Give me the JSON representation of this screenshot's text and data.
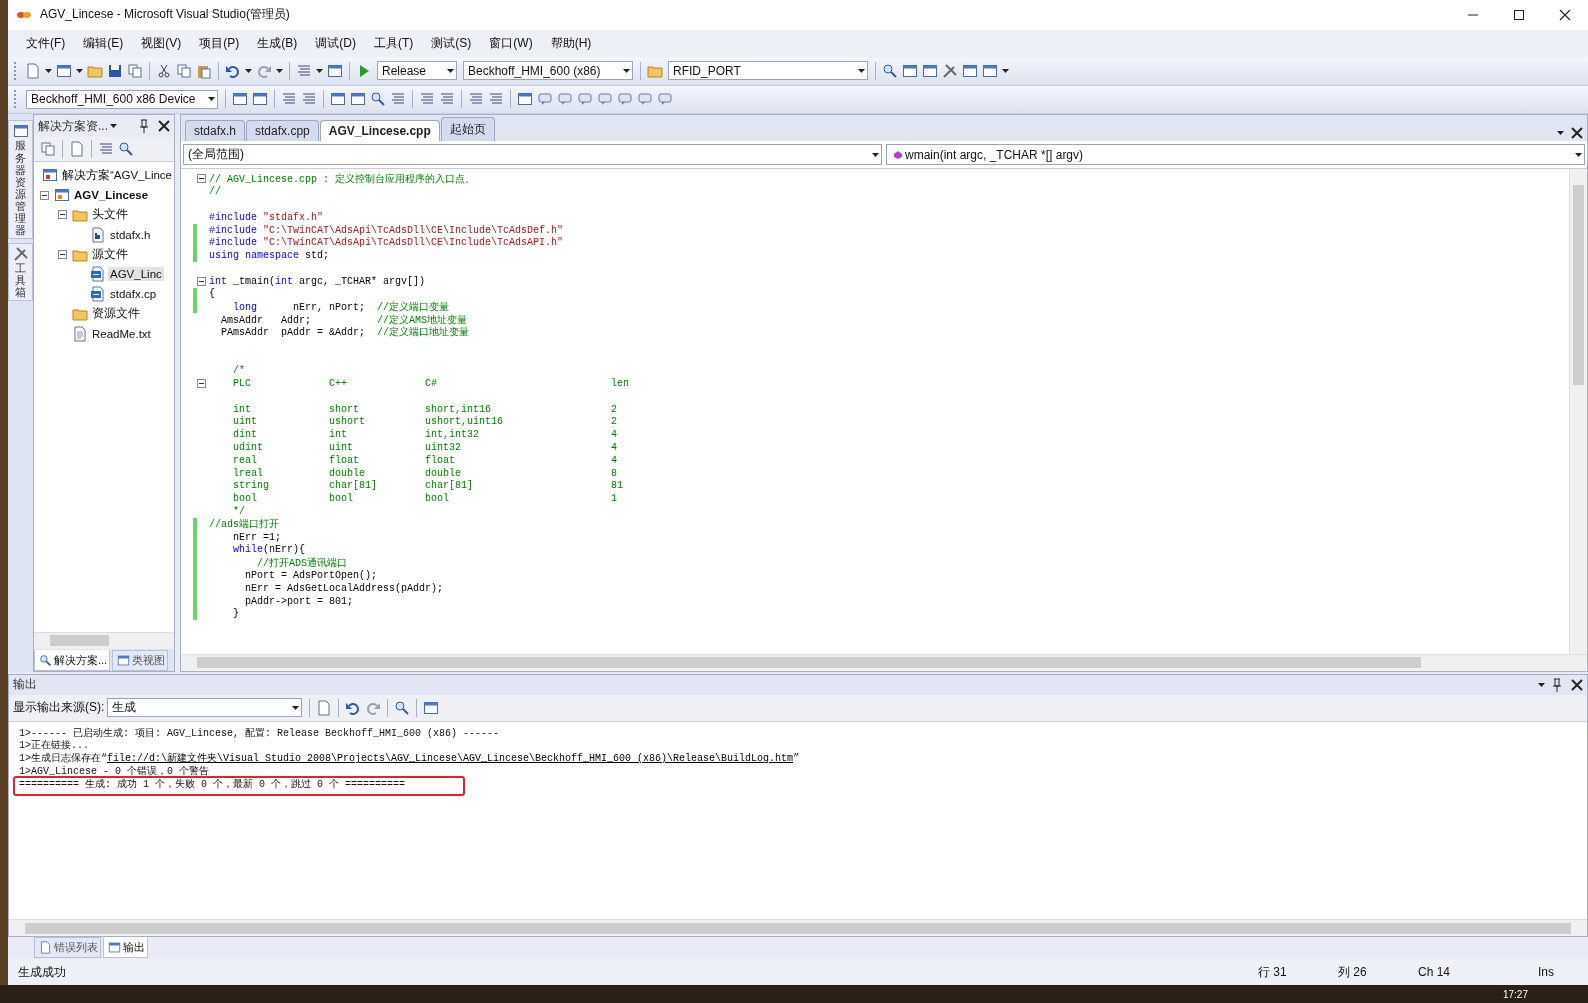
{
  "window": {
    "title": "AGV_Lincese - Microsoft Visual Studio(管理员)"
  },
  "menu": [
    "文件(F)",
    "编辑(E)",
    "视图(V)",
    "项目(P)",
    "生成(B)",
    "调试(D)",
    "工具(T)",
    "测试(S)",
    "窗口(W)",
    "帮助(H)"
  ],
  "toolbar": {
    "configuration": "Release",
    "platform": "Beckhoff_HMI_600 (x86)",
    "find": "RFID_PORT",
    "device": "Beckhoff_HMI_600 x86 Device"
  },
  "side_strip": [
    "服务器资源管理器",
    "工具箱"
  ],
  "solution_explorer": {
    "title": "解决方案资...",
    "solution": {
      "label": "解决方案“AGV_Lince"
    },
    "project": {
      "label": "AGV_Lincese",
      "kind": "project",
      "expanded": true,
      "selected": false,
      "children": [
        {
          "label": "头文件",
          "kind": "folder",
          "expanded": true,
          "selected": false,
          "children": [
            {
              "label": "stdafx.h",
              "kind": "header",
              "expanded": false,
              "selected": false
            }
          ]
        },
        {
          "label": "源文件",
          "kind": "folder",
          "expanded": true,
          "selected": false,
          "children": [
            {
              "label": "AGV_Linc",
              "kind": "cpp",
              "expanded": false,
              "selected": true
            },
            {
              "label": "stdafx.cp",
              "kind": "cpp",
              "expanded": false,
              "selected": false
            }
          ]
        },
        {
          "label": "资源文件",
          "kind": "folder",
          "expanded": false,
          "selected": false
        },
        {
          "label": "ReadMe.txt",
          "kind": "text",
          "expanded": false,
          "selected": false
        }
      ]
    },
    "tabs": [
      {
        "label": "解决方案...",
        "selected": true
      },
      {
        "label": "类视图",
        "selected": false
      }
    ]
  },
  "editor": {
    "tabs": [
      {
        "label": "stdafx.h",
        "selected": false
      },
      {
        "label": "stdafx.cpp",
        "selected": false
      },
      {
        "label": "AGV_Lincese.cpp",
        "selected": true
      },
      {
        "label": "起始页",
        "selected": false
      }
    ],
    "scope": "(全局范围)",
    "member": "wmain(int argc, _TCHAR *[] argv)",
    "lines": [
      {
        "changed": false,
        "fold": true,
        "segs": [
          {
            "kind": "comment",
            "text": "// AGV_Lincese.cpp : 定义控制台应用程序的入口点。"
          }
        ]
      },
      {
        "changed": false,
        "fold": false,
        "segs": [
          {
            "kind": "comment",
            "text": "//"
          }
        ]
      },
      {
        "changed": false,
        "fold": false
      },
      {
        "changed": false,
        "fold": false,
        "segs": [
          {
            "kind": "keyword",
            "text": "#include"
          },
          {
            "kind": "string",
            "text": " \"stdafx.h\""
          }
        ]
      },
      {
        "changed": true,
        "fold": false,
        "segs": [
          {
            "kind": "keyword",
            "text": "#include"
          },
          {
            "kind": "string",
            "text": " \"C:\\TwinCAT\\AdsApi\\TcAdsDll\\CE\\Include\\TcAdsDef.h\""
          }
        ]
      },
      {
        "changed": true,
        "fold": false,
        "segs": [
          {
            "kind": "keyword",
            "text": "#include"
          },
          {
            "kind": "string",
            "text": " \"C:\\TwinCAT\\AdsApi\\TcAdsDll\\CE\\Include\\TcAdsAPI.h\""
          }
        ]
      },
      {
        "changed": true,
        "fold": false,
        "segs": [
          {
            "kind": "keyword",
            "text": "using namespace"
          },
          {
            "kind": "plain",
            "text": " std;"
          }
        ]
      },
      {
        "changed": false,
        "fold": false
      },
      {
        "changed": false,
        "fold": true,
        "segs": [
          {
            "kind": "keyword",
            "text": "int"
          },
          {
            "kind": "plain",
            "text": " _tmain("
          },
          {
            "kind": "keyword",
            "text": "int"
          },
          {
            "kind": "plain",
            "text": " argc, _TCHAR* argv[])"
          }
        ]
      },
      {
        "changed": true,
        "fold": false,
        "segs": [
          {
            "kind": "plain",
            "text": "{"
          }
        ]
      },
      {
        "changed": true,
        "fold": false,
        "segs": [
          {
            "kind": "keyword",
            "text": "    long"
          },
          {
            "kind": "plain",
            "text": "      nErr, nPort;  "
          },
          {
            "kind": "comment",
            "text": "//定义端口变量"
          }
        ]
      },
      {
        "changed": false,
        "fold": false,
        "segs": [
          {
            "kind": "plain",
            "text": "  AmsAddr   Addr;           "
          },
          {
            "kind": "comment",
            "text": "//定义AMS地址变量"
          }
        ]
      },
      {
        "changed": false,
        "fold": false,
        "segs": [
          {
            "kind": "plain",
            "text": "  PAmsAddr  pAddr = &Addr;  "
          },
          {
            "kind": "comment",
            "text": "//定义端口地址变量"
          }
        ]
      },
      {
        "changed": false,
        "fold": false
      },
      {
        "changed": false,
        "fold": false
      },
      {
        "changed": false,
        "fold": false,
        "segs": [
          {
            "kind": "comment",
            "text": "    /*"
          }
        ]
      },
      {
        "changed": false,
        "fold": true,
        "segs": [
          {
            "kind": "comment",
            "text": "    PLC             C++             C#                             len"
          }
        ]
      },
      {
        "changed": false,
        "fold": false
      },
      {
        "changed": false,
        "fold": false,
        "segs": [
          {
            "kind": "comment",
            "text": "    int             short           short,int16                    2"
          }
        ]
      },
      {
        "changed": false,
        "fold": false,
        "segs": [
          {
            "kind": "comment",
            "text": "    uint            ushort          ushort,uint16                  2"
          }
        ]
      },
      {
        "changed": false,
        "fold": false,
        "segs": [
          {
            "kind": "comment",
            "text": "    dint            int             int,int32                      4"
          }
        ]
      },
      {
        "changed": false,
        "fold": false,
        "segs": [
          {
            "kind": "comment",
            "text": "    udint           uint            uint32                         4"
          }
        ]
      },
      {
        "changed": false,
        "fold": false,
        "segs": [
          {
            "kind": "comment",
            "text": "    real            float           float                          4"
          }
        ]
      },
      {
        "changed": false,
        "fold": false,
        "segs": [
          {
            "kind": "comment",
            "text": "    lreal           double          double                         8"
          }
        ]
      },
      {
        "changed": false,
        "fold": false,
        "segs": [
          {
            "kind": "comment",
            "text": "    string          char[81]        char[81]                       81"
          }
        ]
      },
      {
        "changed": false,
        "fold": false,
        "segs": [
          {
            "kind": "comment",
            "text": "    bool            bool            bool                           1"
          }
        ]
      },
      {
        "changed": false,
        "fold": false,
        "segs": [
          {
            "kind": "comment",
            "text": "    */"
          }
        ]
      },
      {
        "changed": true,
        "fold": false,
        "segs": [
          {
            "kind": "comment",
            "text": "//ads端口打开"
          }
        ]
      },
      {
        "changed": true,
        "fold": false,
        "segs": [
          {
            "kind": "plain",
            "text": "    nErr =1;"
          }
        ]
      },
      {
        "changed": true,
        "fold": false,
        "segs": [
          {
            "kind": "keyword",
            "text": "    while"
          },
          {
            "kind": "plain",
            "text": "(nErr){"
          }
        ]
      },
      {
        "changed": true,
        "fold": false,
        "segs": [
          {
            "kind": "comment",
            "text": "        //打开ADS通讯端口"
          }
        ]
      },
      {
        "changed": true,
        "fold": false,
        "segs": [
          {
            "kind": "plain",
            "text": "      nPort = AdsPortOpen();"
          }
        ]
      },
      {
        "changed": true,
        "fold": false,
        "segs": [
          {
            "kind": "plain",
            "text": "      nErr = AdsGetLocalAddress(pAddr);"
          }
        ]
      },
      {
        "changed": true,
        "fold": false,
        "segs": [
          {
            "kind": "plain",
            "text": "      pAddr->port = 801;"
          }
        ]
      },
      {
        "changed": true,
        "fold": false,
        "segs": [
          {
            "kind": "plain",
            "text": "    }"
          }
        ]
      }
    ]
  },
  "output": {
    "title": "输出",
    "source_label": "显示输出来源(S):",
    "source": "生成",
    "lines": [
      {
        "boxed": false,
        "segs": [
          {
            "kind": "plain",
            "text": "1>------ 已启动生成: 项目: AGV_Lincese, 配置: Release Beckhoff_HMI_600 (x86) ------"
          }
        ]
      },
      {
        "boxed": false,
        "segs": [
          {
            "kind": "plain",
            "text": "1>正在链接..."
          }
        ]
      },
      {
        "boxed": false,
        "segs": [
          {
            "kind": "plain",
            "text": "1>生成日志保存在“"
          },
          {
            "kind": "link",
            "text": "file://d:\\新建文件夹\\Visual Studio 2008\\Projects\\AGV_Lincese\\AGV_Lincese\\Beckhoff_HMI_600 (x86)\\Release\\BuildLog.htm"
          },
          {
            "kind": "plain",
            "text": "”"
          }
        ]
      },
      {
        "boxed": false,
        "segs": [
          {
            "kind": "plain",
            "text": "1>AGV_Lincese - 0 个错误，0 个警告"
          }
        ]
      },
      {
        "boxed": true,
        "segs": [
          {
            "kind": "plain",
            "text": "========== 生成: 成功 1 个，失败 0 个，最新 0 个，跳过 0 个 =========="
          }
        ]
      }
    ]
  },
  "bottom_tabs": [
    {
      "label": "错误列表",
      "selected": false
    },
    {
      "label": "输出",
      "selected": true
    }
  ],
  "status_bar": {
    "message": "生成成功",
    "line": "行 31",
    "column": "列 26",
    "char": "Ch 14",
    "mode": "Ins"
  },
  "taskbar": {
    "clock": "17:27"
  }
}
